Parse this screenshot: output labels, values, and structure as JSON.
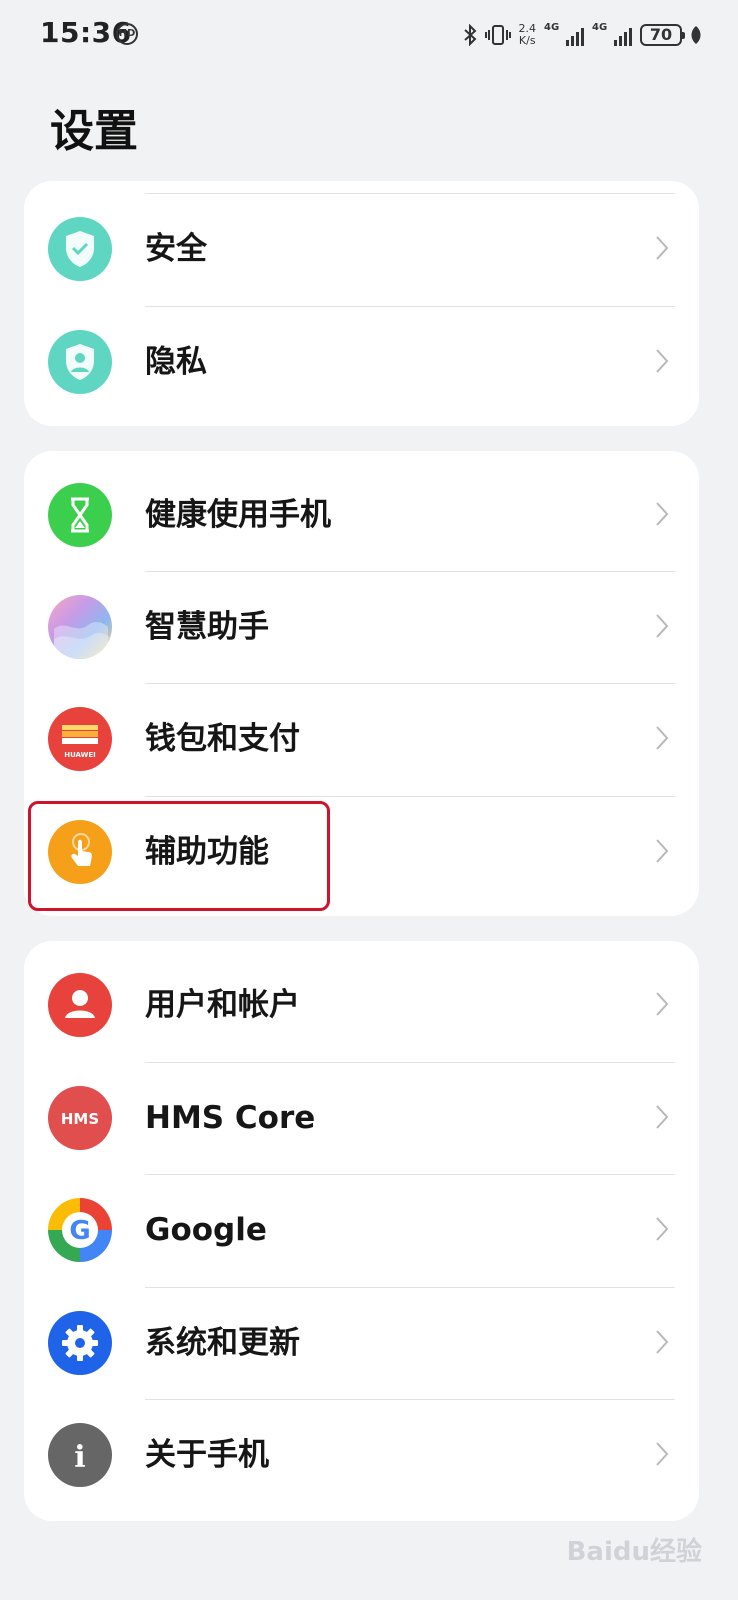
{
  "status_bar": {
    "time": "15:36",
    "hd_badge": "HD",
    "network_speed_value": "2.4",
    "network_speed_unit": "K/s",
    "sim1_tag": "4G",
    "sim2_tag": "4G",
    "battery": "70"
  },
  "page": {
    "title": "设置"
  },
  "groups": [
    {
      "items": [
        {
          "label": "安全",
          "icon": "shield-check-icon",
          "color": "#5ed6c1"
        },
        {
          "label": "隐私",
          "icon": "privacy-shield-icon",
          "color": "#5ed6c1"
        }
      ]
    },
    {
      "items": [
        {
          "label": "健康使用手机",
          "icon": "hourglass-icon",
          "color": "#3ccf4e"
        },
        {
          "label": "智慧助手",
          "icon": "assistant-icon",
          "color": "#c89be6"
        },
        {
          "label": "钱包和支付",
          "icon": "wallet-icon",
          "color": "#e8423d"
        },
        {
          "label": "辅助功能",
          "icon": "accessibility-hand-icon",
          "color": "#f6a01a"
        }
      ]
    },
    {
      "items": [
        {
          "label": "用户和帐户",
          "icon": "user-icon",
          "color": "#e8423d"
        },
        {
          "label": "HMS Core",
          "icon": "hms-core-icon",
          "color": "#e04e4e"
        },
        {
          "label": "Google",
          "icon": "google-icon",
          "color": "#4285f4"
        },
        {
          "label": "系统和更新",
          "icon": "gear-icon",
          "color": "#1f63e8"
        },
        {
          "label": "关于手机",
          "icon": "info-icon",
          "color": "#666666"
        }
      ]
    }
  ],
  "wallet_icon_text": "HUAWEI",
  "hms_icon_text": "HMS",
  "google_icon_text": "G",
  "info_icon_text": "i",
  "watermark": "Baidu经验"
}
